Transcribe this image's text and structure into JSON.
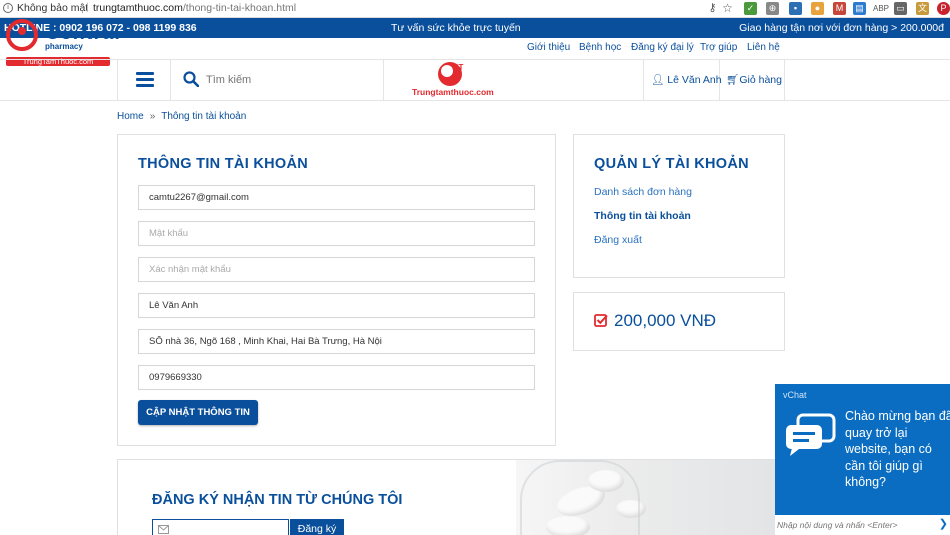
{
  "browser": {
    "security_label": "Không bảo mật",
    "url_host": "trungtamthuoc.com",
    "url_path": "/thong-tin-tai-khoan.html"
  },
  "topbar": {
    "hotline": "HOTLINE : 0902 196 072 - 098 1199 836",
    "consult": "Tư vấn sức khỏe trực tuyến",
    "shipping": "Giao hàng tận nơi với đơn hàng > 200.000đ"
  },
  "logo": {
    "brand": "Central",
    "sub": "pharmacy",
    "site": "TrungTamThuoc.com",
    "center_site": "Trungtamthuoc.com",
    "center_mark": "3T"
  },
  "subnav": [
    "Giới thiệu",
    "Bệnh học",
    "Đăng ký đại lý",
    "Trợ giúp",
    "Liên hệ"
  ],
  "header": {
    "search_placeholder": "Tìm kiếm",
    "user_name": "Lê Văn Anh",
    "cart_label": "Giỏ hàng"
  },
  "breadcrumb": {
    "home": "Home",
    "separator": "»",
    "current": "Thông tin tài khoản"
  },
  "account_form": {
    "title": "THÔNG TIN TÀI KHOẢN",
    "email": "camtu2267@gmail.com",
    "password_placeholder": "Mật khẩu",
    "confirm_placeholder": "Xác nhận mật khẩu",
    "full_name": "Lê Văn Anh",
    "address": "SỐ nhà 36, Ngõ 168 , Minh Khai, Hai Bà Trưng, Hà Nội",
    "phone": "0979669330",
    "submit_label": "CẬP NHẬT THÔNG TIN"
  },
  "manage": {
    "title": "QUẢN LÝ TÀI KHOẢN",
    "links": [
      "Danh sách đơn hàng",
      "Thông tin tài khoản",
      "Đăng xuất"
    ],
    "active_index": 1
  },
  "balance": {
    "amount": "200,000 VNĐ"
  },
  "newsletter": {
    "title": "ĐĂNG KÝ NHẬN TIN TỪ CHÚNG TÔI",
    "button_label": "Đăng ký"
  },
  "vchat": {
    "brand": "vChat",
    "message_lines": [
      "Chào mừng bạn đã",
      "quay trở lại",
      "website, bạn có",
      "cần tôi giúp gì",
      "không?"
    ],
    "input_placeholder": "Nhập nội dung và nhấn <Enter>"
  },
  "colors": {
    "primary": "#0a4f9c",
    "accent_red": "#e32a2f",
    "chat_blue": "#0a6dc2"
  }
}
